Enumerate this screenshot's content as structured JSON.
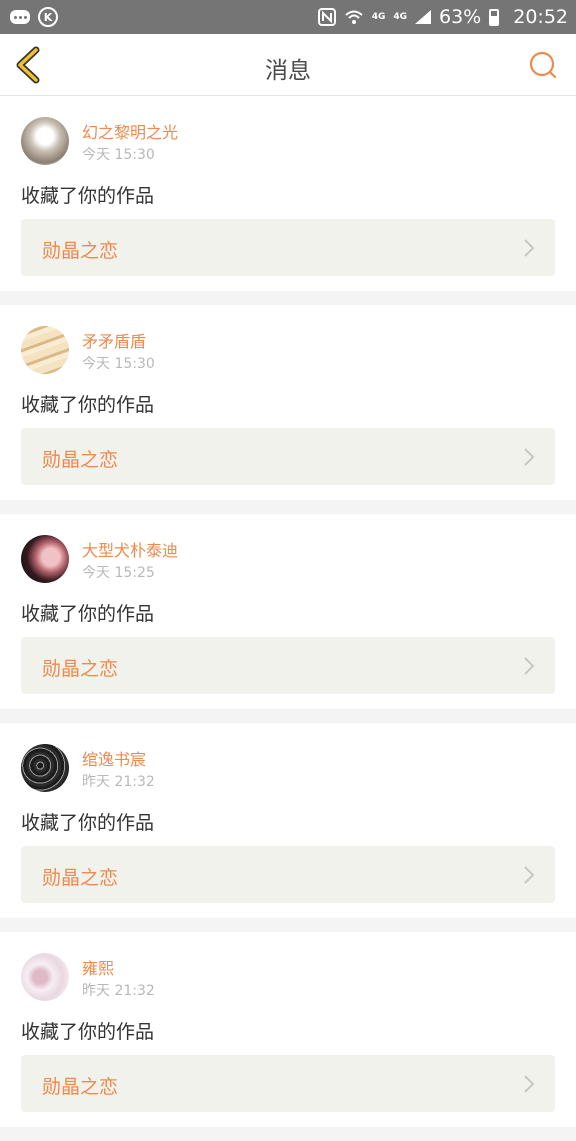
{
  "status_bar": {
    "network_small": "4G",
    "network_small2": "4G",
    "battery_pct": "63%",
    "time": "20:52",
    "icons": [
      "chat-bubble-icon",
      "k-circle-icon",
      "nfc-icon",
      "wifi-icon",
      "signal-icon",
      "battery-icon"
    ]
  },
  "header": {
    "title": "消息",
    "back_icon": "chevron-left-icon",
    "search_icon": "search-icon"
  },
  "colors": {
    "accent": "#ee8a4d",
    "back_accent": "#f0c12b",
    "card_box": "#f2f2ec"
  },
  "messages": [
    {
      "user": "幻之黎明之光",
      "time": "今天 15:30",
      "action": "收藏了你的作品",
      "work": "勋晶之恋"
    },
    {
      "user": "矛矛盾盾",
      "time": "今天 15:30",
      "action": "收藏了你的作品",
      "work": "勋晶之恋"
    },
    {
      "user": "大型犬朴泰迪",
      "time": "今天 15:25",
      "action": "收藏了你的作品",
      "work": "勋晶之恋"
    },
    {
      "user": "绾逸书宸",
      "time": "昨天 21:32",
      "action": "收藏了你的作品",
      "work": "勋晶之恋"
    },
    {
      "user": "雍熙",
      "time": "昨天 21:32",
      "action": "收藏了你的作品",
      "work": "勋晶之恋"
    }
  ]
}
